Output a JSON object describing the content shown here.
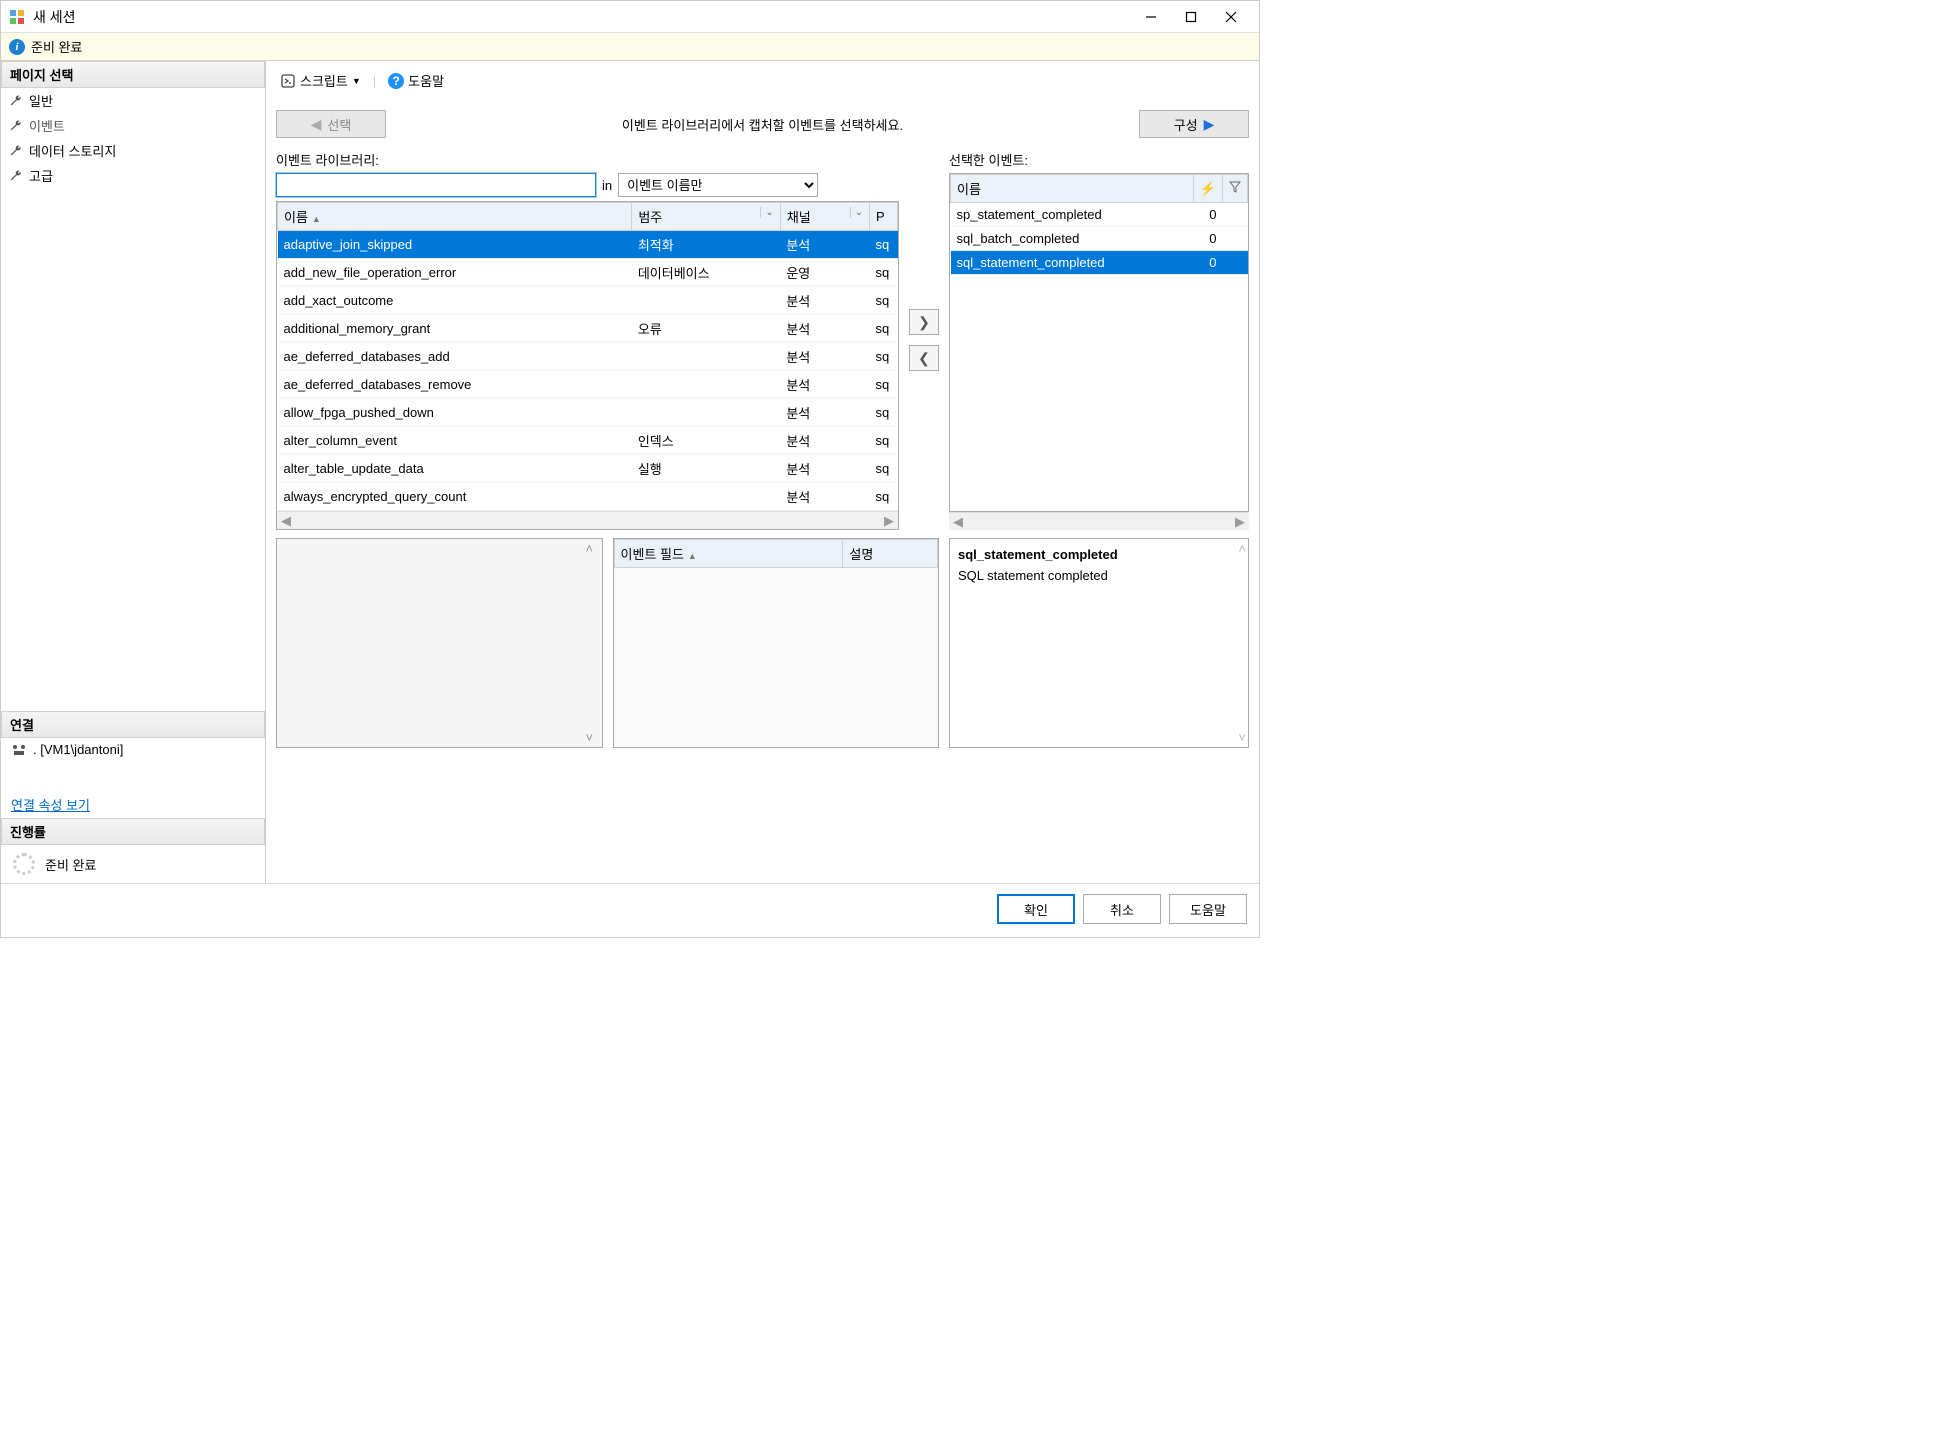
{
  "window": {
    "title": "새 세션"
  },
  "status": {
    "text": "준비 완료"
  },
  "sidebar": {
    "pages_header": "페이지 선택",
    "items": [
      "일반",
      "이벤트",
      "데이터 스토리지",
      "고급"
    ],
    "connection_header": "연결",
    "connection": ". [VM1\\jdantoni]",
    "view_conn_link": "연결 속성 보기",
    "progress_header": "진행률",
    "progress_text": "준비 완료"
  },
  "toolbar": {
    "script": "스크립트",
    "help": "도움말"
  },
  "wizard": {
    "back": "선택",
    "message": "이벤트 라이브러리에서 캡처할 이벤트를 선택하세요.",
    "forward": "구성"
  },
  "library": {
    "label": "이벤트 라이브러리:",
    "search_placeholder": "",
    "in_label": "in",
    "filter": "이벤트 이름만",
    "cols": {
      "name": "이름",
      "category": "범주",
      "channel": "채널",
      "p": "P"
    },
    "rows": [
      {
        "name": "adaptive_join_skipped",
        "category": "최적화",
        "channel": "분석",
        "p": "sq",
        "selected": true
      },
      {
        "name": "add_new_file_operation_error",
        "category": "데이터베이스",
        "channel": "운영",
        "p": "sq"
      },
      {
        "name": "add_xact_outcome",
        "category": "",
        "channel": "분석",
        "p": "sq"
      },
      {
        "name": "additional_memory_grant",
        "category": "오류",
        "channel": "분석",
        "p": "sq"
      },
      {
        "name": "ae_deferred_databases_add",
        "category": "",
        "channel": "분석",
        "p": "sq"
      },
      {
        "name": "ae_deferred_databases_remove",
        "category": "",
        "channel": "분석",
        "p": "sq"
      },
      {
        "name": "allow_fpga_pushed_down",
        "category": "",
        "channel": "분석",
        "p": "sq"
      },
      {
        "name": "alter_column_event",
        "category": "인덱스",
        "channel": "분석",
        "p": "sq"
      },
      {
        "name": "alter_table_update_data",
        "category": "실행",
        "channel": "분석",
        "p": "sq"
      },
      {
        "name": "always_encrypted_query_count",
        "category": "",
        "channel": "분석",
        "p": "sq"
      }
    ]
  },
  "selected": {
    "label": "선택한 이벤트:",
    "cols": {
      "name": "이름"
    },
    "rows": [
      {
        "name": "sp_statement_completed",
        "v": "0"
      },
      {
        "name": "sql_batch_completed",
        "v": "0"
      },
      {
        "name": "sql_statement_completed",
        "v": "0",
        "selected": true
      }
    ]
  },
  "fields": {
    "col1": "이벤트 필드",
    "col2": "설명"
  },
  "detail": {
    "title": "sql_statement_completed",
    "desc": "SQL statement completed"
  },
  "buttons": {
    "ok": "확인",
    "cancel": "취소",
    "help": "도움말"
  }
}
